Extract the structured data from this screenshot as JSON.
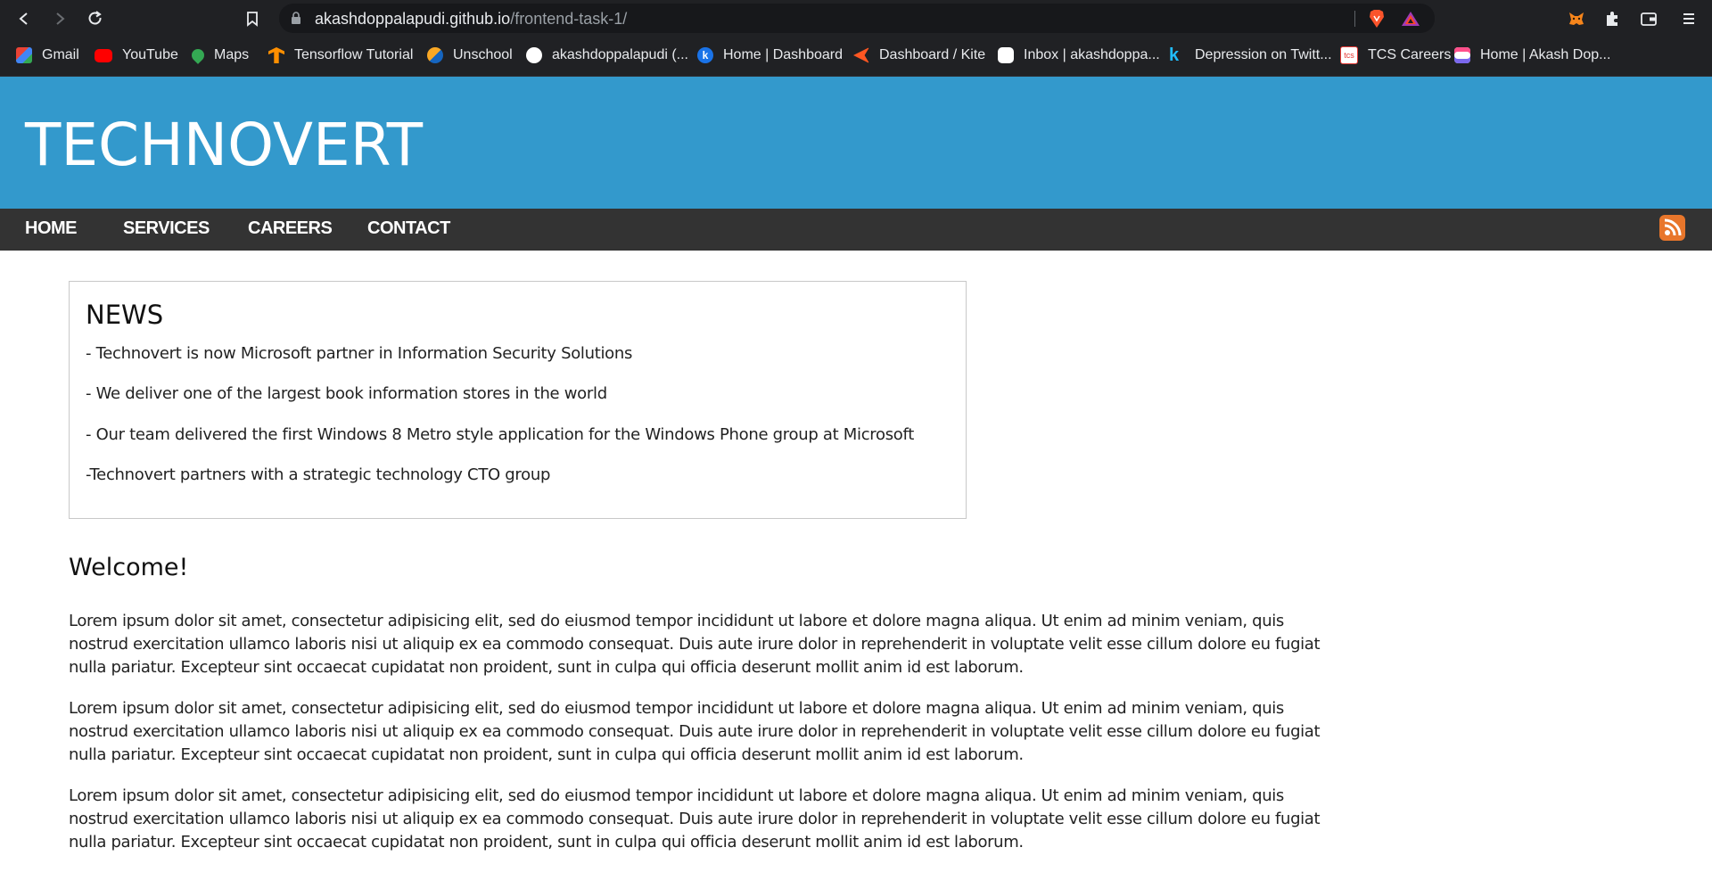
{
  "browser": {
    "url_host": "akashdoppalapudi.github.io",
    "url_path": "/frontend-task-1/",
    "bookmarks": [
      {
        "label": "Gmail",
        "icon": "gmail-icon",
        "color": "#ea4335"
      },
      {
        "label": "YouTube",
        "icon": "youtube-icon",
        "color": "#ff0000"
      },
      {
        "label": "Maps",
        "icon": "maps-icon",
        "color": "#34a853"
      },
      {
        "label": "Tensorflow Tutorial",
        "icon": "tensorflow-icon",
        "color": "#ff8f00"
      },
      {
        "label": "Unschool",
        "icon": "unschool-icon",
        "color": "#f9a825"
      },
      {
        "label": "akashdoppalapudi (...",
        "icon": "github-icon",
        "color": "#ffffff"
      },
      {
        "label": "Home | Dashboard",
        "icon": "k-icon",
        "color": "#1a73e8"
      },
      {
        "label": "Dashboard / Kite",
        "icon": "kite-icon",
        "color": "#ff5722"
      },
      {
        "label": "Inbox | akashdoppa...",
        "icon": "inbox-icon",
        "color": "#ffffff"
      },
      {
        "label": "Depression on Twitt...",
        "icon": "kaggle-icon",
        "color": "#20beff"
      },
      {
        "label": "TCS Careers",
        "icon": "tcs-icon",
        "color": "#e53935"
      },
      {
        "label": "Home | Akash Dop...",
        "icon": "clickup-icon",
        "color": "#7b68ee"
      }
    ]
  },
  "site": {
    "logo": "TECHNOVERT",
    "header_color": "#3399cc",
    "nav": [
      "HOME",
      "SERVICES",
      "CAREERS",
      "CONTACT"
    ],
    "rss_icon": "rss-icon",
    "news": {
      "title": "NEWS",
      "items": [
        "- Technovert is now  Microsoft partner in  Information Security Solutions",
        "- We deliver one of the largest book information stores in the world",
        "- Our team delivered the first Windows 8  Metro style application for the Windows  Phone group at  Microsoft",
        "-Technovert partners with a strategic technology CTO group"
      ]
    },
    "welcome": {
      "title": "Welcome!",
      "paragraphs": [
        "Lorem ipsum dolor sit amet, consectetur adipisicing elit, sed do eiusmod tempor incididunt ut labore et dolore magna aliqua. Ut enim ad minim veniam, quis nostrud exercitation ullamco laboris nisi ut aliquip ex ea commodo consequat.  Duis aute irure dolor in reprehenderit in voluptate velit esse cillum dolore eu fugiat nulla pariatur. Excepteur sint occaecat cupidatat non proident, sunt in culpa qui officia deserunt mollit anim id est laborum.",
        "Lorem ipsum dolor sit amet, consectetur adipisicing elit, sed do eiusmod tempor incididunt ut labore et dolore magna aliqua. Ut enim ad minim veniam, quis nostrud exercitation ullamco laboris nisi ut aliquip ex ea commodo consequat.  Duis aute irure dolor in reprehenderit in voluptate velit esse cillum dolore eu fugiat nulla pariatur. Excepteur sint occaecat cupidatat non proident, sunt in culpa qui officia deserunt mollit anim id est laborum.",
        "Lorem ipsum dolor sit amet, consectetur adipisicing elit, sed do eiusmod tempor incididunt ut labore et dolore magna aliqua. Ut enim ad minim veniam, quis nostrud exercitation ullamco laboris nisi ut aliquip ex ea commodo consequat.  Duis aute irure dolor in reprehenderit in voluptate velit esse cillum dolore eu fugiat nulla pariatur. Excepteur sint occaecat cupidatat non proident, sunt in culpa qui officia deserunt mollit anim id est laborum."
      ]
    }
  }
}
